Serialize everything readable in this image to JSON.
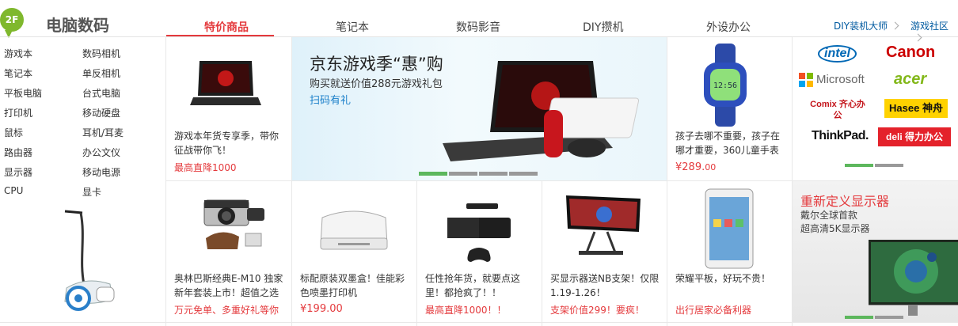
{
  "floor": {
    "badge": "2F",
    "title": "电脑数码"
  },
  "tabs": [
    "特价商品",
    "笔记本",
    "数码影音",
    "DIY攒机",
    "外设办公"
  ],
  "ext_links": [
    "DIY装机大师",
    "游戏社区"
  ],
  "categories": [
    "游戏本",
    "数码相机",
    "笔记本",
    "单反相机",
    "平板电脑",
    "台式电脑",
    "打印机",
    "移动硬盘",
    "鼠标",
    "耳机/耳麦",
    "路由器",
    "办公文仪",
    "显示器",
    "移动电源",
    "CPU",
    "显卡"
  ],
  "laptop_promo": {
    "desc": "游戏本年货专享季，带你征战带你飞！",
    "promo": "最高直降1000"
  },
  "banner": {
    "title": "京东游戏季“惠”购",
    "subtitle": "购买就送价值288元游戏礼包",
    "link": "扫码有礼",
    "slides": 4,
    "active_slide": 0
  },
  "watch": {
    "desc": "孩子去哪不重要，孩子在哪才重要，360儿童手表",
    "price": "¥289.",
    "price_cents": "00"
  },
  "brands": {
    "names": [
      "intel",
      "Canon",
      "Microsoft",
      "acer",
      "Comix 齐心办公",
      "Hasee 神舟",
      "ThinkPad.",
      "deli 得力办公"
    ],
    "slides": 2,
    "active_slide": 0
  },
  "products": [
    {
      "desc": "奥林巴斯经典E-M10 独家新年套装上市！超值之选",
      "promo": "万元免单、多重好礼等你"
    },
    {
      "desc": "标配原装双墨盒！佳能彩色喷墨打印机",
      "price": "¥199.00"
    },
    {
      "desc": "任性抢年货，就要点这里！都抢疯了！！",
      "promo": "最高直降1000！！"
    },
    {
      "desc": "买显示器送NB支架！仅限1.19-1.26！",
      "promo": "支架价值299！要疯！"
    },
    {
      "desc": "荣耀平板，好玩不贵！",
      "promo": "出行居家必备利器"
    }
  ],
  "monitor_ad": {
    "title": "重新定义显示器",
    "line1": "戴尔全球首款",
    "line2": "超高清5K显示器",
    "slides": 2,
    "active_slide": 0
  },
  "colors": {
    "accent": "#e4393c",
    "badge": "#7fb82d",
    "link": "#005aa0",
    "slider_on": "#5db75d"
  }
}
